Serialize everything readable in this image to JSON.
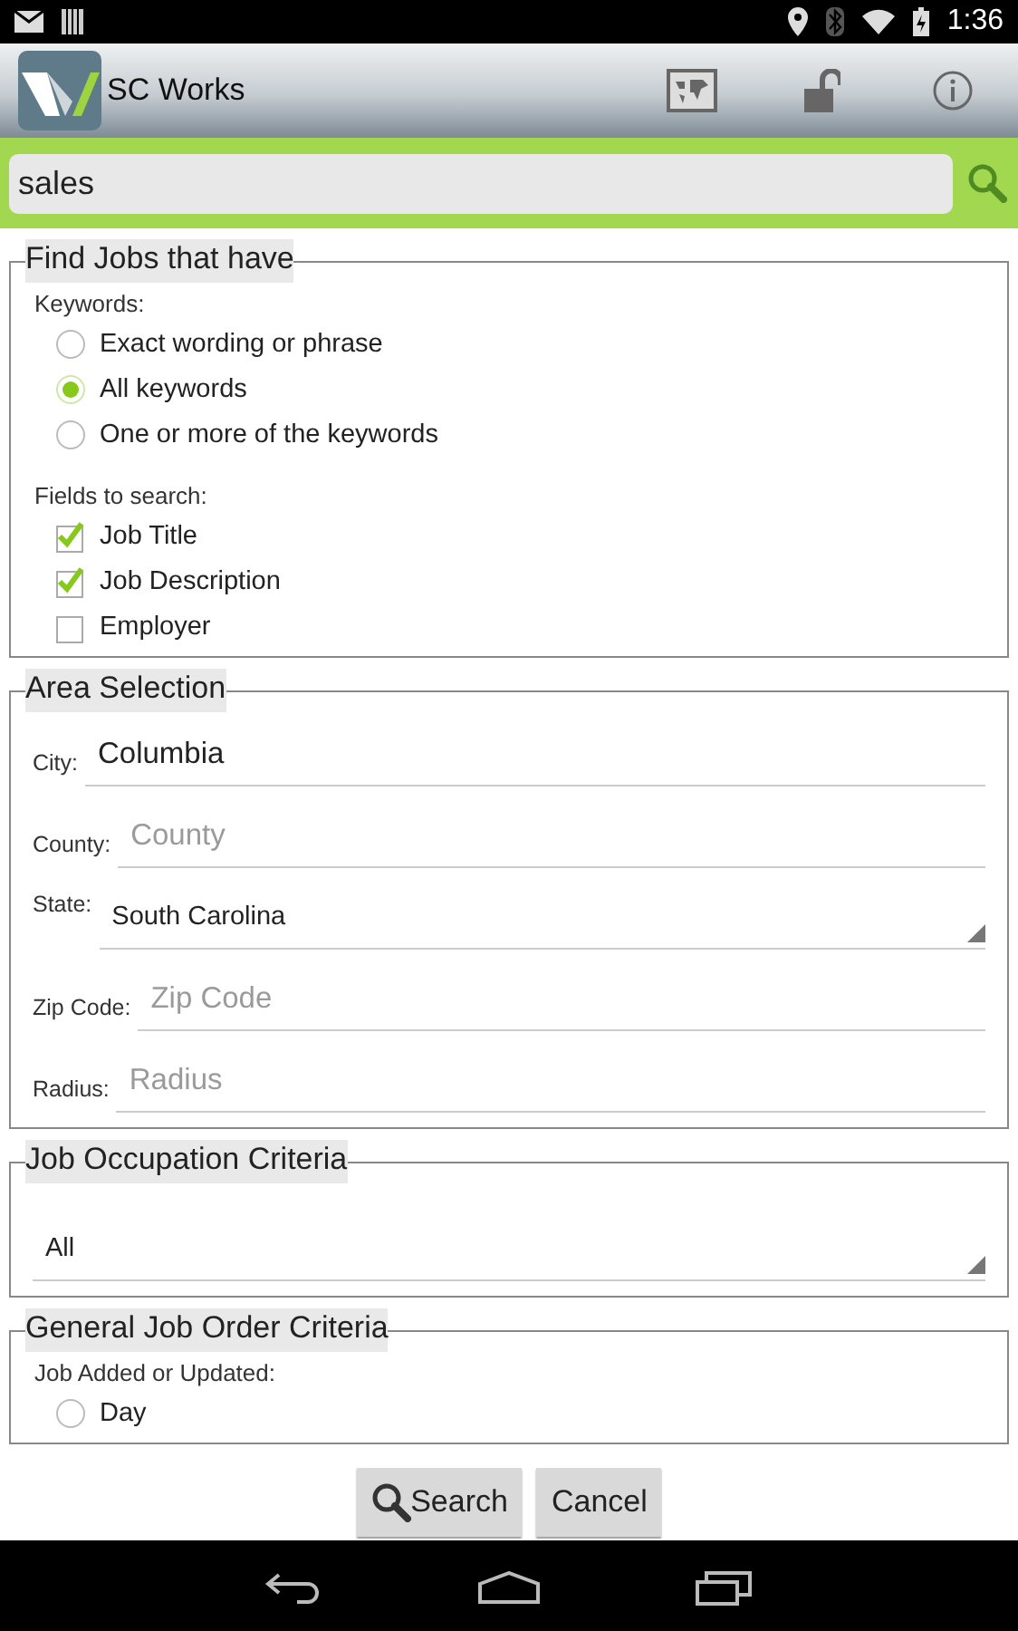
{
  "status_bar": {
    "time": "1:36"
  },
  "action_bar": {
    "title": "SC Works"
  },
  "search": {
    "value": "sales"
  },
  "sections": [
    {
      "title": "Find Jobs that have",
      "items": [
        {
          "kind": "label",
          "text": "Keywords:"
        },
        {
          "kind": "radio",
          "label": "Exact wording or phrase",
          "selected": false
        },
        {
          "kind": "radio",
          "label": "All keywords",
          "selected": true
        },
        {
          "kind": "radio",
          "label": "One or more of the keywords",
          "selected": false
        },
        {
          "kind": "label",
          "text": "Fields to search:"
        },
        {
          "kind": "checkbox",
          "label": "Job Title",
          "checked": true
        },
        {
          "kind": "checkbox",
          "label": "Job Description",
          "checked": true
        },
        {
          "kind": "checkbox",
          "label": "Employer",
          "checked": false
        }
      ]
    },
    {
      "title": "Area Selection",
      "items": [
        {
          "kind": "text",
          "label": "City:",
          "value": "Columbia"
        },
        {
          "kind": "text",
          "label": "County:",
          "placeholder": "County"
        },
        {
          "kind": "dropdown",
          "label": "State:",
          "value": "South Carolina"
        },
        {
          "kind": "text",
          "label": "Zip Code:",
          "placeholder": "Zip Code"
        },
        {
          "kind": "text",
          "label": "Radius:",
          "placeholder": "Radius"
        }
      ]
    },
    {
      "title": "Job Occupation Criteria",
      "items": [
        {
          "kind": "dropdown",
          "value": "All"
        }
      ]
    },
    {
      "title": "General Job Order Criteria",
      "items": [
        {
          "kind": "label",
          "text": "Job Added or Updated:"
        },
        {
          "kind": "radio",
          "label": "Day",
          "selected": false
        }
      ]
    }
  ],
  "buttons": [
    {
      "kind": "search",
      "label": "Search"
    },
    {
      "kind": "plain",
      "label": "Cancel"
    }
  ]
}
